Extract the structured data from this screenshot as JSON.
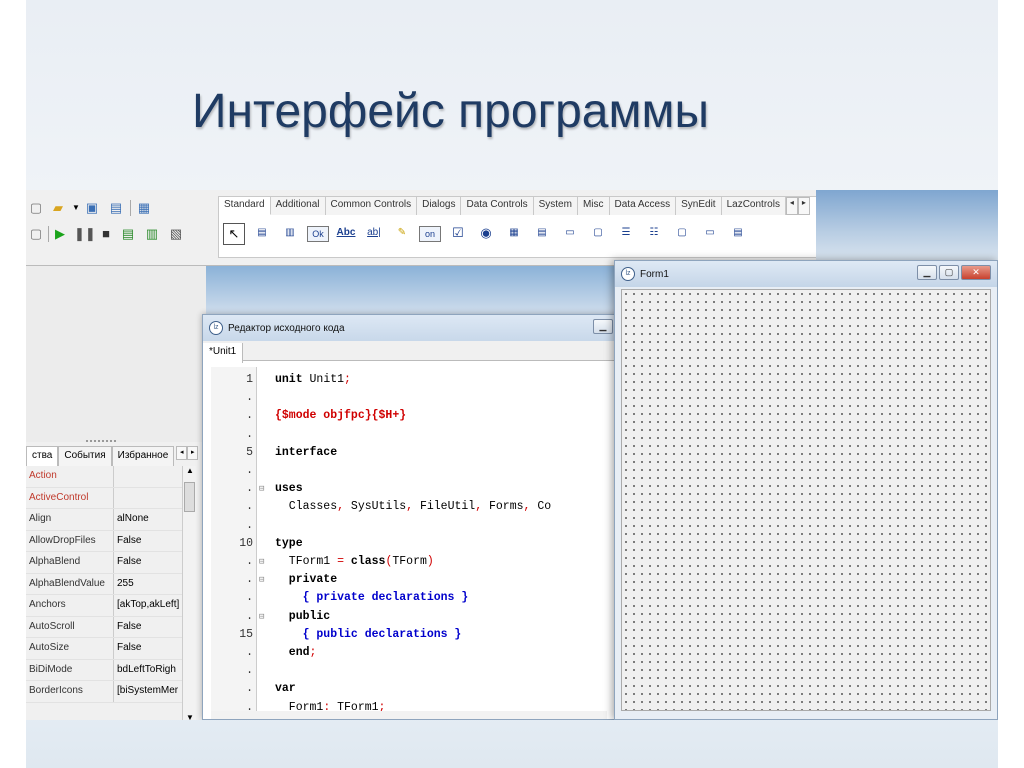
{
  "slide": {
    "title": "Интерфейс программы"
  },
  "ide": {
    "toolbar_icons": [
      "new-icon",
      "open-icon",
      "save-icon",
      "save-all-icon",
      "project-icon",
      "run-icon",
      "pause-icon",
      "stop-icon",
      "step-into-icon",
      "step-over-icon",
      "step-out-icon"
    ],
    "palette_tabs": [
      "Standard",
      "Additional",
      "Common Controls",
      "Dialogs",
      "Data Controls",
      "System",
      "Misc",
      "Data Access",
      "SynEdit",
      "LazControls"
    ],
    "palette_arrows": [
      "◂",
      "▸"
    ],
    "components": {
      "button_ok": "Ok",
      "label_abc": "Abc",
      "edit_ab": "ab|",
      "toggle_on": "on",
      "checkbox": "☑",
      "radio": "◉"
    }
  },
  "object_inspector": {
    "tabs": [
      "ства",
      "События",
      "Избранное"
    ],
    "tab_arrows": [
      "◂",
      "▸"
    ],
    "properties": [
      {
        "name": "Action",
        "value": ""
      },
      {
        "name": "ActiveControl",
        "value": ""
      },
      {
        "name": "Align",
        "value": "alNone"
      },
      {
        "name": "AllowDropFiles",
        "value": "False"
      },
      {
        "name": "AlphaBlend",
        "value": "False"
      },
      {
        "name": "AlphaBlendValue",
        "value": "255"
      },
      {
        "name": "Anchors",
        "value": "[akTop,akLeft]"
      },
      {
        "name": "AutoScroll",
        "value": "False"
      },
      {
        "name": "AutoSize",
        "value": "False"
      },
      {
        "name": "BiDiMode",
        "value": "bdLeftToRigh"
      },
      {
        "name": "BorderIcons",
        "value": "[biSystemMer"
      }
    ]
  },
  "editor": {
    "title": "Редактор исходного кода",
    "tab": "*Unit1",
    "lines": [
      {
        "n": "1",
        "parts": [
          {
            "t": "unit",
            "c": "kw"
          },
          {
            "t": " Unit1",
            "c": ""
          },
          {
            "t": ";",
            "c": "sym"
          }
        ]
      },
      {
        "n": ".",
        "parts": []
      },
      {
        "n": ".",
        "parts": [
          {
            "t": "{$mode objfpc}{$H+}",
            "c": "dir"
          }
        ]
      },
      {
        "n": ".",
        "parts": []
      },
      {
        "n": "5",
        "parts": [
          {
            "t": "interface",
            "c": "kw"
          }
        ]
      },
      {
        "n": ".",
        "parts": []
      },
      {
        "n": ".",
        "fold": "⊟",
        "parts": [
          {
            "t": "uses",
            "c": "kw"
          }
        ]
      },
      {
        "n": ".",
        "parts": [
          {
            "t": "  Classes",
            "c": ""
          },
          {
            "t": ",",
            "c": "sym"
          },
          {
            "t": " SysUtils",
            "c": ""
          },
          {
            "t": ",",
            "c": "sym"
          },
          {
            "t": " FileUtil",
            "c": ""
          },
          {
            "t": ",",
            "c": "sym"
          },
          {
            "t": " Forms",
            "c": ""
          },
          {
            "t": ",",
            "c": "sym"
          },
          {
            "t": " Co",
            "c": ""
          }
        ]
      },
      {
        "n": ".",
        "parts": []
      },
      {
        "n": "10",
        "parts": [
          {
            "t": "type",
            "c": "kw"
          }
        ]
      },
      {
        "n": ".",
        "fold": "⊟",
        "parts": [
          {
            "t": "  TForm1 ",
            "c": ""
          },
          {
            "t": "=",
            "c": "sym"
          },
          {
            "t": " class",
            "c": "kw"
          },
          {
            "t": "(",
            "c": "sym"
          },
          {
            "t": "TForm",
            "c": ""
          },
          {
            "t": ")",
            "c": "sym"
          }
        ]
      },
      {
        "n": ".",
        "fold": "⊟",
        "parts": [
          {
            "t": "  private",
            "c": "kw"
          }
        ]
      },
      {
        "n": ".",
        "parts": [
          {
            "t": "    { private declarations }",
            "c": "cmt"
          }
        ]
      },
      {
        "n": ".",
        "fold": "⊟",
        "parts": [
          {
            "t": "  public",
            "c": "kw"
          }
        ]
      },
      {
        "n": "15",
        "parts": [
          {
            "t": "    { public declarations }",
            "c": "cmt"
          }
        ]
      },
      {
        "n": ".",
        "parts": [
          {
            "t": "  end",
            "c": "kw"
          },
          {
            "t": ";",
            "c": "sym"
          }
        ]
      },
      {
        "n": ".",
        "parts": []
      },
      {
        "n": ".",
        "parts": [
          {
            "t": "var",
            "c": "kw"
          }
        ]
      },
      {
        "n": ".",
        "parts": [
          {
            "t": "  Form1",
            "c": ""
          },
          {
            "t": ":",
            "c": "sym"
          },
          {
            "t": " TForm1",
            "c": ""
          },
          {
            "t": ";",
            "c": "sym"
          }
        ]
      }
    ]
  },
  "form1": {
    "title": "Form1"
  },
  "window_buttons": {
    "minimize": "▁",
    "maximize": "▢",
    "close": "✕"
  },
  "colors": {
    "title_text": "#1f3b63",
    "keyword": "#000000",
    "directive": "#d00000",
    "comment": "#0000cc"
  }
}
